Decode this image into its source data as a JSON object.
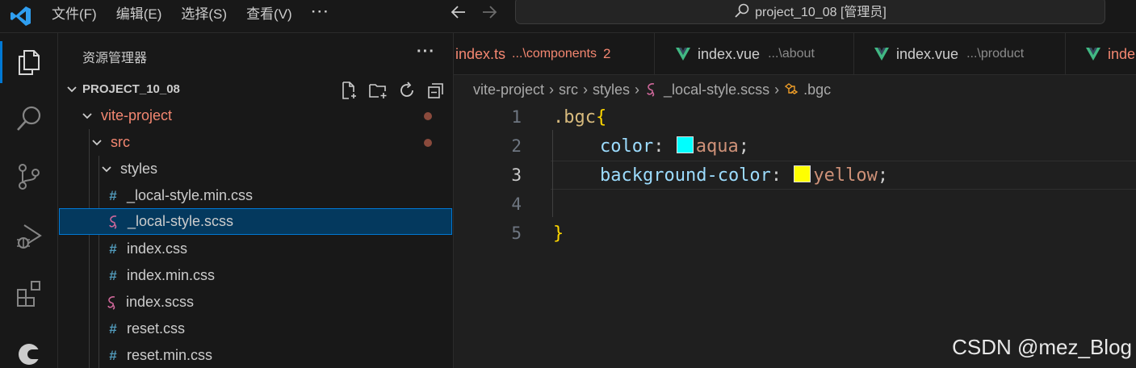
{
  "titlebar": {
    "menu": [
      "文件(F)",
      "编辑(E)",
      "选择(S)",
      "查看(V)",
      "···"
    ],
    "search_text": "project_10_08 [管理员]"
  },
  "activitybar": {
    "items": [
      "explorer-icon",
      "search-icon",
      "source-control-icon",
      "run-debug-icon",
      "extensions-icon",
      "remote-icon"
    ]
  },
  "sidebar": {
    "title": "资源管理器",
    "more": "···",
    "project": "PROJECT_10_08",
    "tree": [
      {
        "label": "vite-project",
        "kind": "folder",
        "color": "#f48771"
      },
      {
        "label": "src",
        "kind": "folder",
        "color": "#f48771"
      },
      {
        "label": "styles",
        "kind": "folder",
        "color": "#cccccc"
      },
      {
        "label": "_local-style.min.css",
        "kind": "css",
        "color": "#cccccc"
      },
      {
        "label": "_local-style.scss",
        "kind": "scss",
        "color": "#cccccc",
        "selected": true
      },
      {
        "label": "index.css",
        "kind": "css",
        "color": "#cccccc"
      },
      {
        "label": "index.min.css",
        "kind": "css",
        "color": "#cccccc"
      },
      {
        "label": "index.scss",
        "kind": "scss",
        "color": "#cccccc"
      },
      {
        "label": "reset.css",
        "kind": "css",
        "color": "#cccccc"
      },
      {
        "label": "reset.min.css",
        "kind": "css",
        "color": "#cccccc"
      }
    ]
  },
  "tabs": [
    {
      "label": "index.ts",
      "desc": "...\\components",
      "badge": "2",
      "color": "#f48771"
    },
    {
      "label": "index.vue",
      "desc": "...\\about",
      "color": "#cccccc"
    },
    {
      "label": "index.vue",
      "desc": "...\\product",
      "color": "#cccccc"
    },
    {
      "label": "inde",
      "desc": "",
      "color": "#f48771"
    }
  ],
  "breadcrumb": [
    "vite-project",
    "src",
    "styles",
    "_local-style.scss",
    ".bgc"
  ],
  "editor": {
    "line_numbers": [
      "1",
      "2",
      "3",
      "4",
      "5"
    ],
    "current_line": 3,
    "code": {
      "l1_selector": ".bgc",
      "l1_brace": "{",
      "l2_prop": "color",
      "l2_colon": ": ",
      "l2_value": "aqua",
      "l2_semi": ";",
      "l3_prop": "background-color",
      "l3_colon": ": ",
      "l3_value": "yellow",
      "l3_semi": ";",
      "l5_brace": "}"
    },
    "swatch_colors": {
      "aqua": "#00ffff",
      "yellow": "#ffff00"
    }
  },
  "watermark": "CSDN @mez_Blog"
}
